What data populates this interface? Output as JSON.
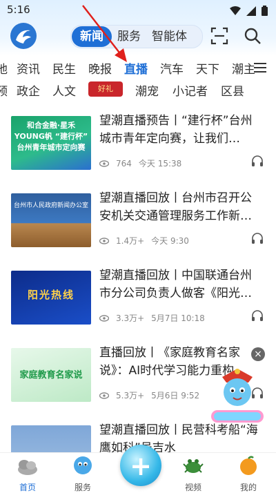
{
  "status_bar": {
    "time": "5:16"
  },
  "header": {
    "segments": [
      {
        "label": "新闻",
        "active": true
      },
      {
        "label": "服务",
        "active": false
      },
      {
        "label": "智能体",
        "active": false
      }
    ]
  },
  "channels_row1": [
    "地",
    "资讯",
    "民生",
    "晚报",
    "直播",
    "汽车",
    "天下",
    "潮主"
  ],
  "channels_row1_active": "直播",
  "channels_row2": [
    "预",
    "政企",
    "人文",
    "潮宠",
    "小记者",
    "区县"
  ],
  "haoli_badge": "好礼",
  "news": [
    {
      "title": "望潮直播预告丨“建行杯”台州城市青年定向赛，让我们…",
      "views": "764",
      "date": "今天 15:38",
      "thumb_text": "和合金融·星禾YOUNG帆 “建行杯” 台州青年城市定向赛"
    },
    {
      "title": "望潮直播回放丨台州市召开公安机关交通管理服务工作新…",
      "views": "1.4万+",
      "date": "今天 9:30",
      "thumb_text": "台州市人民政府新闻办公室"
    },
    {
      "title": "望潮直播回放丨中国联通台州市分公司负责人做客《阳光…",
      "views": "3.3万+",
      "date": "5月7日 10:18",
      "thumb_text": "阳光热线"
    },
    {
      "title": "直播回放丨《家庭教育名家说》：AI时代学习能力重构…",
      "views": "5.3万+",
      "date": "5月6日 9:52",
      "thumb_text": "家庭教育名家说"
    },
    {
      "title": "望潮直播回放丨民营科考船“海鹰如科”号吉水",
      "views": "",
      "date": "",
      "thumb_text": ""
    }
  ],
  "bottom_nav": [
    {
      "label": "首页",
      "icon": "home-icon",
      "active": true
    },
    {
      "label": "服务",
      "icon": "service-icon",
      "active": false
    },
    {
      "label": "视频",
      "icon": "video-icon",
      "active": false
    },
    {
      "label": "我的",
      "icon": "profile-icon",
      "active": false
    }
  ],
  "colors": {
    "accent": "#1f6fd6",
    "text": "#222222",
    "meta": "#888888",
    "annotation_arrow": "#e0201c"
  }
}
